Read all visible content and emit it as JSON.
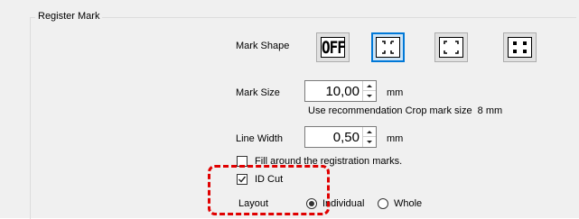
{
  "group": {
    "title": "Register Mark"
  },
  "mark_shape": {
    "label": "Mark Shape",
    "options": [
      {
        "name": "off",
        "text": "OFF",
        "selected": false
      },
      {
        "name": "corner-outward",
        "selected": true
      },
      {
        "name": "corner-inward",
        "selected": false
      },
      {
        "name": "filled-squares",
        "selected": false
      }
    ]
  },
  "mark_size": {
    "label": "Mark Size",
    "value": "10,00",
    "unit": "mm",
    "hint": "Use recommendation Crop mark size  8 mm"
  },
  "line_width": {
    "label": "Line Width",
    "value": "0,50",
    "unit": "mm"
  },
  "fill_around": {
    "label": "Fill around the registration marks.",
    "checked": false
  },
  "id_cut": {
    "label": "ID Cut",
    "checked": true
  },
  "layout": {
    "label": "Layout",
    "options": [
      {
        "label": "Individual",
        "selected": true
      },
      {
        "label": "Whole",
        "selected": false
      }
    ]
  },
  "colors": {
    "highlight": "#e00000",
    "selected_border": "#0078d7"
  },
  "icons": [
    "spin-up-arrow-icon",
    "spin-down-arrow-icon",
    "checkmark-icon"
  ]
}
